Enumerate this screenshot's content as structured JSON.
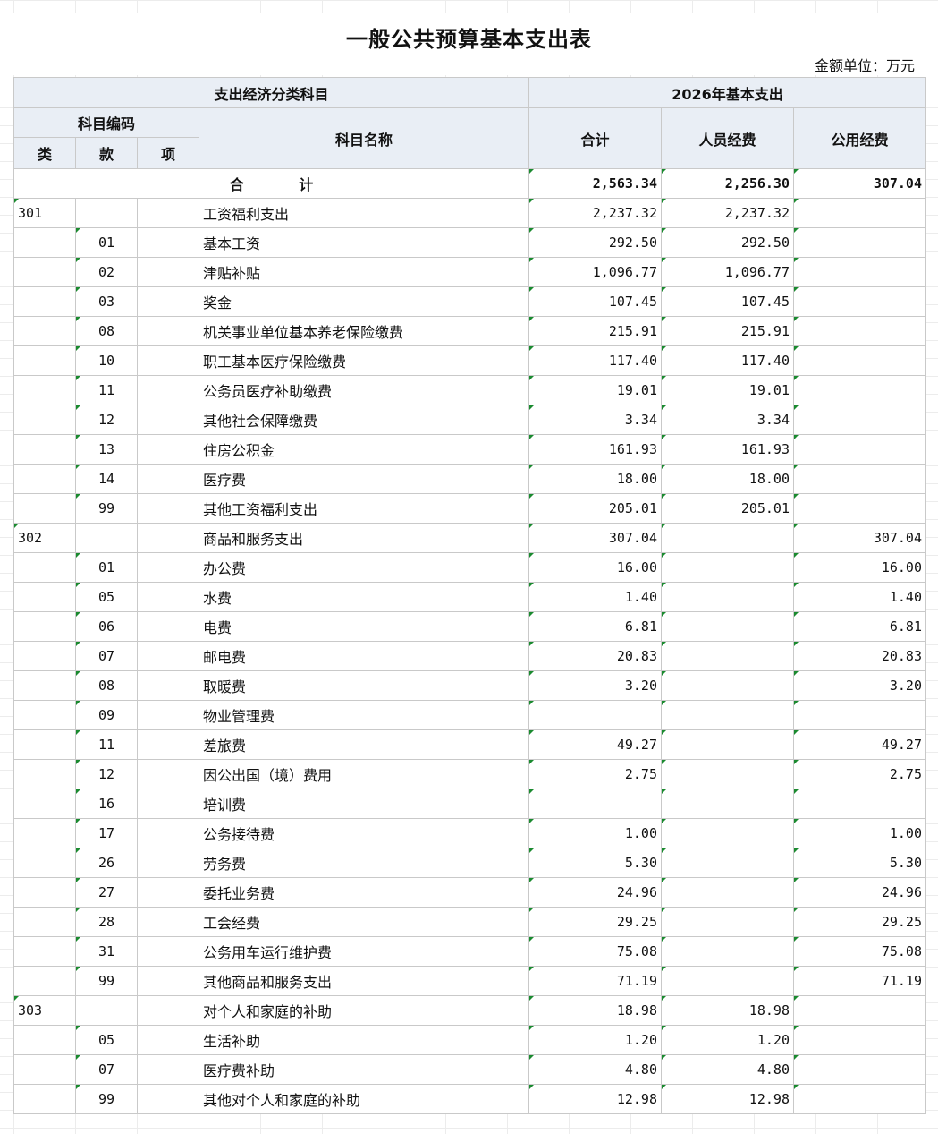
{
  "title": "一般公共预算基本支出表",
  "unit": "金额单位：万元",
  "header": {
    "group_econ": "支出经济分类科目",
    "group_year": "2026年基本支出",
    "code": "科目编码",
    "lei": "类",
    "kuan": "款",
    "xiang": "项",
    "name": "科目名称",
    "total": "合计",
    "personnel": "人员经费",
    "public": "公用经费"
  },
  "total_row": {
    "label": "合 计",
    "total": "2,563.34",
    "personnel": "2,256.30",
    "public": "307.04"
  },
  "rows": [
    {
      "lei": "301",
      "kuan": "",
      "xiang": "",
      "name": "工资福利支出",
      "total": "2,237.32",
      "personnel": "2,237.32",
      "public": ""
    },
    {
      "lei": "",
      "kuan": "01",
      "xiang": "",
      "name": "基本工资",
      "total": "292.50",
      "personnel": "292.50",
      "public": ""
    },
    {
      "lei": "",
      "kuan": "02",
      "xiang": "",
      "name": "津贴补贴",
      "total": "1,096.77",
      "personnel": "1,096.77",
      "public": ""
    },
    {
      "lei": "",
      "kuan": "03",
      "xiang": "",
      "name": "奖金",
      "total": "107.45",
      "personnel": "107.45",
      "public": ""
    },
    {
      "lei": "",
      "kuan": "08",
      "xiang": "",
      "name": "机关事业单位基本养老保险缴费",
      "total": "215.91",
      "personnel": "215.91",
      "public": ""
    },
    {
      "lei": "",
      "kuan": "10",
      "xiang": "",
      "name": "职工基本医疗保险缴费",
      "total": "117.40",
      "personnel": "117.40",
      "public": ""
    },
    {
      "lei": "",
      "kuan": "11",
      "xiang": "",
      "name": "公务员医疗补助缴费",
      "total": "19.01",
      "personnel": "19.01",
      "public": ""
    },
    {
      "lei": "",
      "kuan": "12",
      "xiang": "",
      "name": "其他社会保障缴费",
      "total": "3.34",
      "personnel": "3.34",
      "public": ""
    },
    {
      "lei": "",
      "kuan": "13",
      "xiang": "",
      "name": "住房公积金",
      "total": "161.93",
      "personnel": "161.93",
      "public": ""
    },
    {
      "lei": "",
      "kuan": "14",
      "xiang": "",
      "name": "医疗费",
      "total": "18.00",
      "personnel": "18.00",
      "public": ""
    },
    {
      "lei": "",
      "kuan": "99",
      "xiang": "",
      "name": "其他工资福利支出",
      "total": "205.01",
      "personnel": "205.01",
      "public": ""
    },
    {
      "lei": "302",
      "kuan": "",
      "xiang": "",
      "name": "商品和服务支出",
      "total": "307.04",
      "personnel": "",
      "public": "307.04"
    },
    {
      "lei": "",
      "kuan": "01",
      "xiang": "",
      "name": "办公费",
      "total": "16.00",
      "personnel": "",
      "public": "16.00"
    },
    {
      "lei": "",
      "kuan": "05",
      "xiang": "",
      "name": "水费",
      "total": "1.40",
      "personnel": "",
      "public": "1.40"
    },
    {
      "lei": "",
      "kuan": "06",
      "xiang": "",
      "name": "电费",
      "total": "6.81",
      "personnel": "",
      "public": "6.81"
    },
    {
      "lei": "",
      "kuan": "07",
      "xiang": "",
      "name": "邮电费",
      "total": "20.83",
      "personnel": "",
      "public": "20.83"
    },
    {
      "lei": "",
      "kuan": "08",
      "xiang": "",
      "name": "取暖费",
      "total": "3.20",
      "personnel": "",
      "public": "3.20"
    },
    {
      "lei": "",
      "kuan": "09",
      "xiang": "",
      "name": "物业管理费",
      "total": "",
      "personnel": "",
      "public": ""
    },
    {
      "lei": "",
      "kuan": "11",
      "xiang": "",
      "name": "差旅费",
      "total": "49.27",
      "personnel": "",
      "public": "49.27"
    },
    {
      "lei": "",
      "kuan": "12",
      "xiang": "",
      "name": "因公出国（境）费用",
      "total": "2.75",
      "personnel": "",
      "public": "2.75"
    },
    {
      "lei": "",
      "kuan": "16",
      "xiang": "",
      "name": "培训费",
      "total": "",
      "personnel": "",
      "public": ""
    },
    {
      "lei": "",
      "kuan": "17",
      "xiang": "",
      "name": "公务接待费",
      "total": "1.00",
      "personnel": "",
      "public": "1.00"
    },
    {
      "lei": "",
      "kuan": "26",
      "xiang": "",
      "name": "劳务费",
      "total": "5.30",
      "personnel": "",
      "public": "5.30"
    },
    {
      "lei": "",
      "kuan": "27",
      "xiang": "",
      "name": "委托业务费",
      "total": "24.96",
      "personnel": "",
      "public": "24.96"
    },
    {
      "lei": "",
      "kuan": "28",
      "xiang": "",
      "name": "工会经费",
      "total": "29.25",
      "personnel": "",
      "public": "29.25"
    },
    {
      "lei": "",
      "kuan": "31",
      "xiang": "",
      "name": "公务用车运行维护费",
      "total": "75.08",
      "personnel": "",
      "public": "75.08"
    },
    {
      "lei": "",
      "kuan": "99",
      "xiang": "",
      "name": "其他商品和服务支出",
      "total": "71.19",
      "personnel": "",
      "public": "71.19"
    },
    {
      "lei": "303",
      "kuan": "",
      "xiang": "",
      "name": "对个人和家庭的补助",
      "total": "18.98",
      "personnel": "18.98",
      "public": ""
    },
    {
      "lei": "",
      "kuan": "05",
      "xiang": "",
      "name": "生活补助",
      "total": "1.20",
      "personnel": "1.20",
      "public": ""
    },
    {
      "lei": "",
      "kuan": "07",
      "xiang": "",
      "name": "医疗费补助",
      "total": "4.80",
      "personnel": "4.80",
      "public": ""
    },
    {
      "lei": "",
      "kuan": "99",
      "xiang": "",
      "name": "其他对个人和家庭的补助",
      "total": "12.98",
      "personnel": "12.98",
      "public": ""
    }
  ],
  "colors": {
    "header_bg": "#e9eef5",
    "grid_border": "#c9c9c9",
    "cell_marker": "#1a8a2f"
  }
}
